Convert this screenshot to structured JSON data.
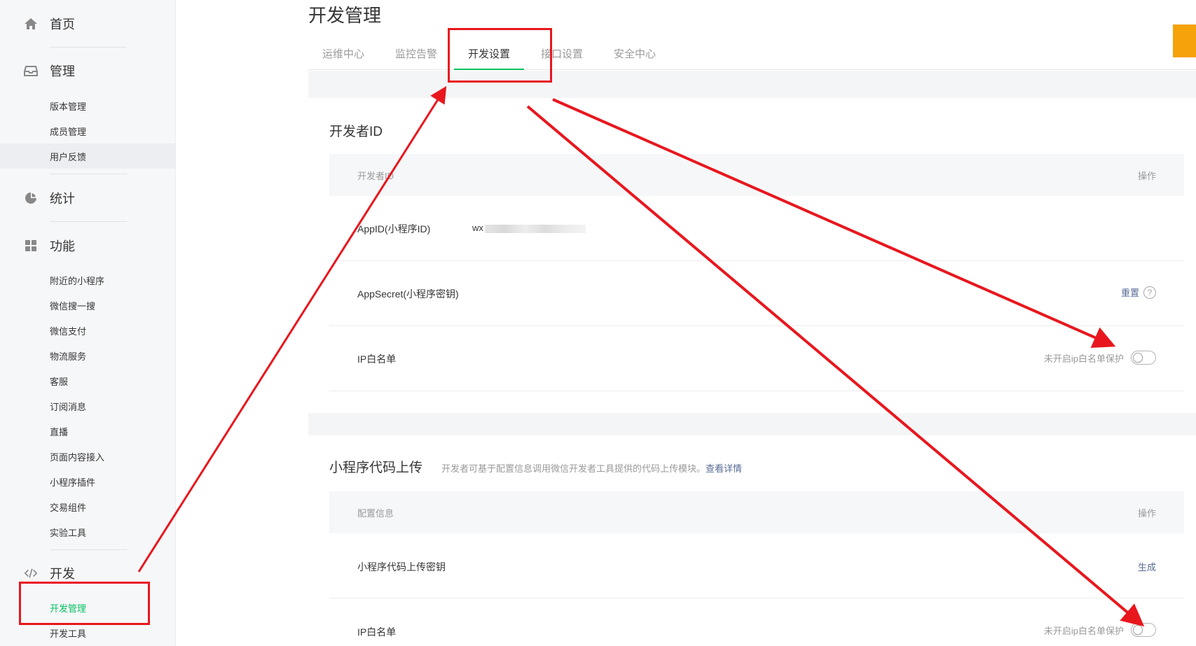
{
  "sidebar": {
    "home": {
      "label": "首页",
      "icon": "home-icon"
    },
    "manage": {
      "label": "管理",
      "icon": "inbox-icon",
      "items": [
        "版本管理",
        "成员管理",
        "用户反馈"
      ]
    },
    "stats": {
      "label": "统计",
      "icon": "pie-chart-icon"
    },
    "features": {
      "label": "功能",
      "icon": "grid-icon",
      "items": [
        "附近的小程序",
        "微信搜一搜",
        "微信支付",
        "物流服务",
        "客服",
        "订阅消息",
        "直播",
        "页面内容接入",
        "小程序插件",
        "交易组件",
        "实验工具"
      ]
    },
    "dev": {
      "label": "开发",
      "icon": "code-icon",
      "items": [
        "开发管理",
        "开发工具"
      ],
      "active_item": "开发管理"
    }
  },
  "main": {
    "title": "开发管理",
    "tabs": [
      "运维中心",
      "监控告警",
      "开发设置",
      "接口设置",
      "安全中心"
    ],
    "active_tab": "开发设置"
  },
  "developer_id_card": {
    "title": "开发者ID",
    "header": {
      "col1": "开发者ID",
      "col2": "操作"
    },
    "rows": [
      {
        "key": "AppID(小程序ID)",
        "value_prefix": "wx"
      },
      {
        "key": "AppSecret(小程序密钥)",
        "action": "重置",
        "help": "?"
      },
      {
        "key": "IP白名单",
        "switch_status": "未开启ip白名单保护",
        "switch_on": false
      }
    ]
  },
  "upload_card": {
    "title": "小程序代码上传",
    "desc": "开发者可基于配置信息调用微信开发者工具提供的代码上传模块。",
    "desc_link": "查看详情",
    "header": {
      "col1": "配置信息",
      "col2": "操作"
    },
    "rows": [
      {
        "key": "小程序代码上传密钥",
        "action": "生成"
      },
      {
        "key": "IP白名单",
        "switch_status": "未开启ip白名单保护",
        "switch_on": false
      }
    ]
  },
  "colors": {
    "accent_green": "#07c160",
    "link_blue": "#576b95",
    "annotation_red": "#e8171e",
    "corner_orange": "#f5a20b"
  }
}
